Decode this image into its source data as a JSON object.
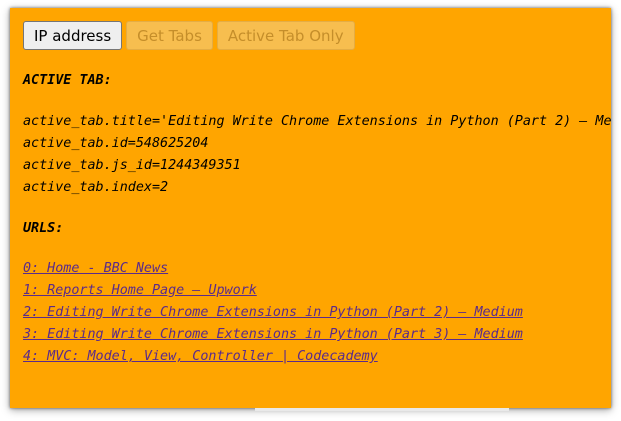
{
  "toolbar": {
    "ip_address_label": "IP address",
    "get_tabs_label": "Get Tabs",
    "active_tab_only_label": "Active Tab Only"
  },
  "active_tab": {
    "heading": "ACTIVE TAB:",
    "title_line": "active_tab.title='Editing Write Chrome Extensions in Python (Part 2) – Me",
    "id_line": "active_tab.id=548625204",
    "js_id_line": "active_tab.js_id=1244349351",
    "index_line": "active_tab.index=2"
  },
  "urls": {
    "heading": "URLS:",
    "items": [
      {
        "label": "0: Home - BBC News"
      },
      {
        "label": "1: Reports Home Page – Upwork"
      },
      {
        "label": "2: Editing Write Chrome Extensions in Python (Part 2) – Medium"
      },
      {
        "label": "3: Editing Write Chrome Extensions in Python (Part 3) – Medium"
      },
      {
        "label": "4: MVC: Model, View, Controller | Codecademy"
      }
    ]
  },
  "colors": {
    "background": "#ffa500",
    "link": "#5b2b8a",
    "disabled_text": "#c58e2a"
  }
}
